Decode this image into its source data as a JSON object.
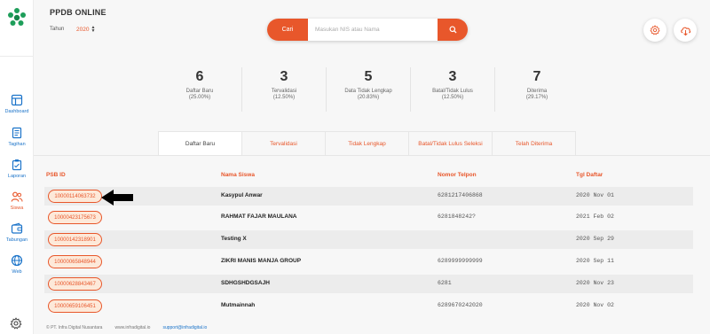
{
  "sidebar": {
    "logo_icon": "flower-logo-icon",
    "items": [
      {
        "label": "Dashboard",
        "icon": "dashboard-icon"
      },
      {
        "label": "Tagihan",
        "icon": "bill-icon"
      },
      {
        "label": "Laporan",
        "icon": "clipboard-icon"
      },
      {
        "label": "Siswa",
        "icon": "users-icon",
        "active": true
      },
      {
        "label": "Tabungan",
        "icon": "wallet-icon"
      },
      {
        "label": "Web",
        "icon": "globe-icon"
      }
    ],
    "settings_icon": "gear-icon"
  },
  "header": {
    "title": "PPDB ONLINE",
    "year_label": "Tahun",
    "year_value": "2020",
    "search_button": "Cari",
    "search_placeholder": "Masukan NIS atau Nama",
    "accent": "#e8572b"
  },
  "stats": [
    {
      "value": "6",
      "label": "Daftar Baru",
      "pct": "(25.00%)"
    },
    {
      "value": "3",
      "label": "Tervalidasi",
      "pct": "(12.50%)"
    },
    {
      "value": "5",
      "label": "Data Tidak Lengkap",
      "pct": "(20.83%)"
    },
    {
      "value": "3",
      "label": "Batal/Tidak Lulus",
      "pct": "(12.50%)"
    },
    {
      "value": "7",
      "label": "Diterima",
      "pct": "(29.17%)"
    }
  ],
  "tabs": [
    {
      "label": "Daftar Baru",
      "active": true
    },
    {
      "label": "Tervalidasi"
    },
    {
      "label": "Tidak Lengkap"
    },
    {
      "label": "Batal/Tidak Lulus Seleksi"
    },
    {
      "label": "Telah Diterima"
    }
  ],
  "table": {
    "headers": [
      "PSB ID",
      "Nama Siswa",
      "Nomor Telpon",
      "Tgl Daftar"
    ],
    "rows": [
      {
        "id": "10000114063732",
        "name": "Kasypul Anwar",
        "phone": "6281217406868",
        "date": "2020 Nov 01"
      },
      {
        "id": "10000423175673",
        "name": "RAHMAT FAJAR MAULANA",
        "phone": "6281848242?",
        "date": "2021 Feb 02"
      },
      {
        "id": "10000142318901",
        "name": "Testing X",
        "phone": "",
        "date": "2020 Sep 29"
      },
      {
        "id": "10000065848944",
        "name": "ZIKRI MANIS MANJA GROUP",
        "phone": "6289999999999",
        "date": "2020 Sep 11"
      },
      {
        "id": "10000628843467",
        "name": "SDHGSHDGSAJH",
        "phone": "6281",
        "date": "2020 Nov 23"
      },
      {
        "id": "10000659106451",
        "name": "Mutmainnah",
        "phone": "6289670242020",
        "date": "2020 Nov 02"
      }
    ]
  },
  "footer": {
    "company": "© PT. Infra Digital Nusantara",
    "website": "www.infradigital.io",
    "email": "support@infradigital.io"
  }
}
